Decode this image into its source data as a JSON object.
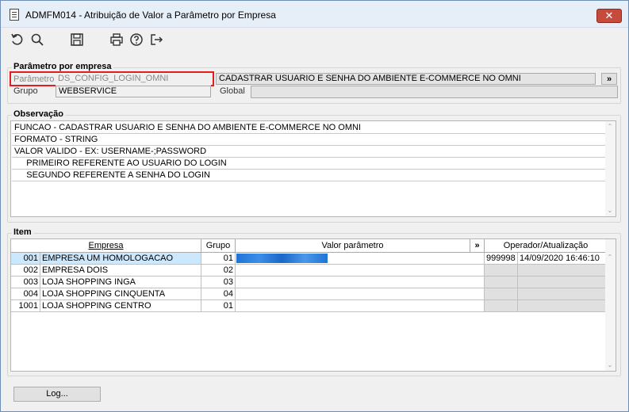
{
  "window": {
    "title": "ADMFM014 - Atribuição de Valor a Parâmetro por Empresa",
    "close_label": "✕"
  },
  "toolbar": {
    "icons": [
      "undo-icon",
      "search-icon",
      "save-icon",
      "print-icon",
      "help-icon",
      "exit-icon"
    ]
  },
  "parametro": {
    "section_title": "Parâmetro por empresa",
    "parametro_label": "Parâmetro",
    "parametro_value": "DS_CONFIG_LOGIN_OMNI",
    "descricao_value": "CADASTRAR USUARIO E SENHA DO AMBIENTE E-COMMERCE NO OMNI",
    "more_button": "»",
    "grupo_label": "Grupo",
    "grupo_value": "WEBSERVICE",
    "global_label": "Global",
    "global_value": ""
  },
  "observacao": {
    "section_title": "Observação",
    "lines": [
      "FUNCAO - CADASTRAR USUARIO E SENHA DO AMBIENTE E-COMMERCE NO OMNI",
      "FORMATO - STRING",
      "VALOR VALIDO - EX: USERNAME-;PASSWORD",
      "     PRIMEIRO REFERENTE AO USUARIO DO LOGIN",
      "     SEGUNDO REFERENTE A SENHA DO LOGIN"
    ]
  },
  "item": {
    "section_title": "Item",
    "headers": {
      "empresa": "Empresa",
      "grupo": "Grupo",
      "valor": "Valor parâmetro",
      "more": "»",
      "operador": "Operador/Atualização"
    },
    "rows": [
      {
        "code": "001",
        "name": "EMPRESA UM HOMOLOGACAO",
        "grupo": "01",
        "valor": "",
        "operador": "999998",
        "data": "14/09/2020 16:46:10"
      },
      {
        "code": "002",
        "name": "EMPRESA DOIS",
        "grupo": "02",
        "valor": "",
        "operador": "",
        "data": ""
      },
      {
        "code": "003",
        "name": "LOJA SHOPPING INGA",
        "grupo": "03",
        "valor": "",
        "operador": "",
        "data": ""
      },
      {
        "code": "004",
        "name": "LOJA SHOPPING CINQUENTA",
        "grupo": "04",
        "valor": "",
        "operador": "",
        "data": ""
      },
      {
        "code": "1001",
        "name": "LOJA SHOPPING  CENTRO",
        "grupo": "01",
        "valor": "",
        "operador": "",
        "data": ""
      }
    ]
  },
  "footer": {
    "log_button": "Log..."
  },
  "colors": {
    "highlight_border": "#e02020",
    "selected_row": "#cce8ff",
    "masked_value": "#1f74d6"
  }
}
